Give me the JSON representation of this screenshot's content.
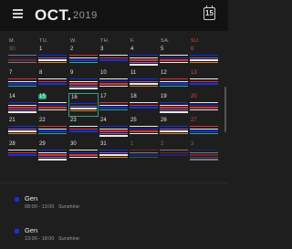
{
  "header": {
    "month": "OCT.",
    "year": "2019",
    "today_button": "15"
  },
  "weekdays": [
    "M.",
    "TU.",
    "W.",
    "TH.",
    "F.",
    "SA.",
    "SU."
  ],
  "weeks": [
    [
      {
        "d": "30",
        "m": true
      },
      {
        "d": "1"
      },
      {
        "d": "2"
      },
      {
        "d": "3"
      },
      {
        "d": "4"
      },
      {
        "d": "5"
      },
      {
        "d": "6",
        "s": true
      }
    ],
    [
      {
        "d": "7"
      },
      {
        "d": "8"
      },
      {
        "d": "9"
      },
      {
        "d": "10"
      },
      {
        "d": "11"
      },
      {
        "d": "12"
      },
      {
        "d": "13",
        "s": true
      }
    ],
    [
      {
        "d": "14"
      },
      {
        "d": "15",
        "t": true
      },
      {
        "d": "16",
        "sel": true
      },
      {
        "d": "17"
      },
      {
        "d": "18"
      },
      {
        "d": "19"
      },
      {
        "d": "20",
        "s": true
      }
    ],
    [
      {
        "d": "21"
      },
      {
        "d": "22"
      },
      {
        "d": "23"
      },
      {
        "d": "24"
      },
      {
        "d": "25"
      },
      {
        "d": "26"
      },
      {
        "d": "27",
        "s": true
      }
    ],
    [
      {
        "d": "28"
      },
      {
        "d": "29"
      },
      {
        "d": "30"
      },
      {
        "d": "31"
      },
      {
        "d": "1",
        "m": true
      },
      {
        "d": "2",
        "m": true
      },
      {
        "d": "3",
        "m": true,
        "s": true
      }
    ]
  ],
  "event_colors": {
    "blue": "#1a2fd6",
    "red": "#d6333b",
    "purple": "#8a5cd8",
    "orange": "#e07a1f",
    "teal": "#22a7a0",
    "white": "#e8e8e8"
  },
  "events": [
    {
      "title": "Gen",
      "time": "08:00 - 13:00",
      "label": "Sunshine",
      "color": "#1a2fd6"
    },
    {
      "title": "Gen",
      "time": "13:00 - 18:00",
      "label": "Sunshine",
      "color": "#1a2fd6"
    }
  ],
  "accent": "#1fa77a",
  "sunday_color": "#e0473e"
}
